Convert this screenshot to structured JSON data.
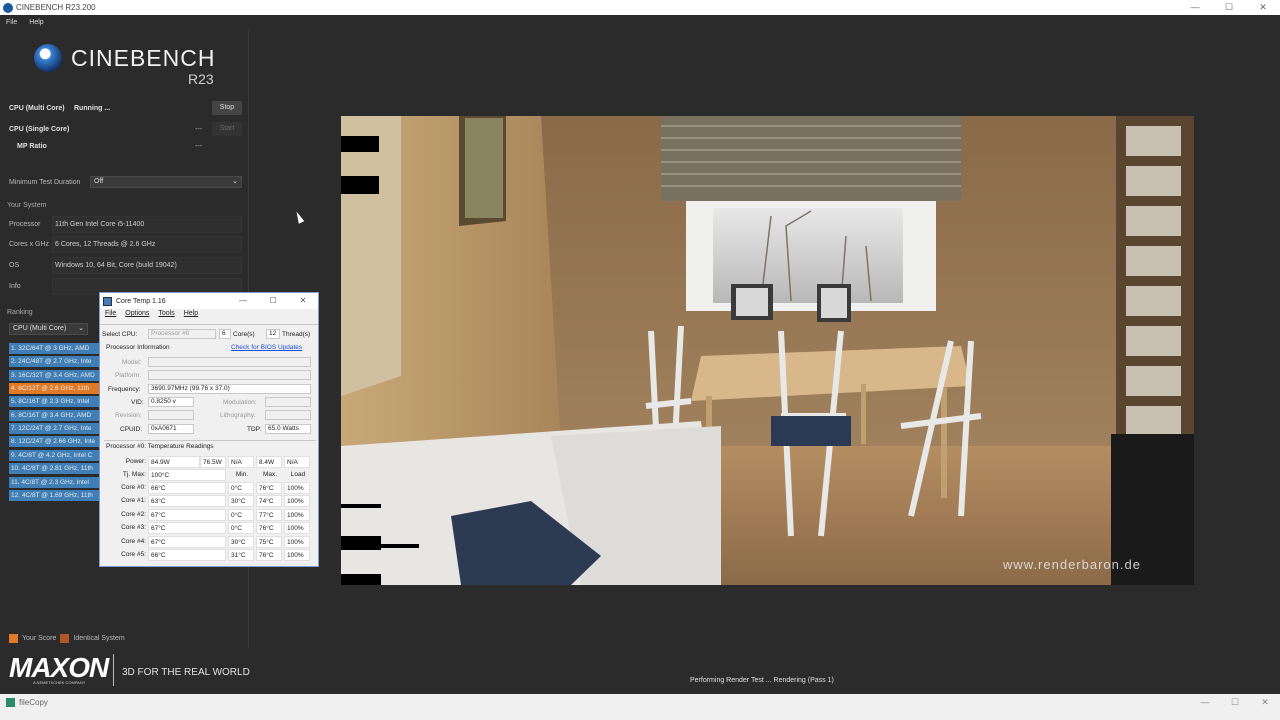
{
  "window": {
    "title": "CINEBENCH R23.200",
    "minimize": "—",
    "maximize": "☐",
    "close": "✕"
  },
  "menu": [
    "File",
    "Help"
  ],
  "logo": {
    "name": "CINEBENCH",
    "version": "R23"
  },
  "tests": {
    "multi": {
      "label": "CPU (Multi Core)",
      "status": "Running ...",
      "button": "Stop"
    },
    "single": {
      "label": "CPU (Single Core)",
      "value": "---",
      "button": "Start"
    },
    "mp": {
      "label": "MP Ratio",
      "value": "---"
    }
  },
  "min_duration": {
    "label": "Minimum Test Duration",
    "value": "Off"
  },
  "system": {
    "heading": "Your System",
    "rows": [
      {
        "label": "Processor",
        "value": "11th Gen Intel Core i5-11400"
      },
      {
        "label": "Cores x GHz",
        "value": "6 Cores, 12 Threads @ 2.6 GHz"
      },
      {
        "label": "OS",
        "value": "Windows 10, 64 Bit, Core (build 19042)"
      },
      {
        "label": "Info",
        "value": ""
      }
    ]
  },
  "ranking": {
    "heading": "Ranking",
    "filter": "CPU (Multi Core)",
    "items": [
      {
        "text": "1. 32C/64T @ 3 GHz, AMD",
        "mine": false
      },
      {
        "text": "2. 24C/48T @ 2.7 GHz, Inte",
        "mine": false
      },
      {
        "text": "3. 16C/32T @ 3.4 GHz, AMD",
        "mine": false
      },
      {
        "text": "4. 6C/12T @ 2.6 GHz, 11th",
        "mine": true
      },
      {
        "text": "5. 8C/16T @ 2.3 GHz, Intel",
        "mine": false
      },
      {
        "text": "6. 8C/16T @ 3.4 GHz, AMD",
        "mine": false
      },
      {
        "text": "7. 12C/24T @ 2.7 GHz, Inte",
        "mine": false
      },
      {
        "text": "8. 12C/24T @ 2.66 GHz, Inte",
        "mine": false
      },
      {
        "text": "9. 4C/8T @ 4.2 GHz, Intel C",
        "mine": false
      },
      {
        "text": "10. 4C/8T @ 2.81 GHz, 11th",
        "mine": false
      },
      {
        "text": "11. 4C/8T @ 2.3 GHz, Intel",
        "mine": false
      },
      {
        "text": "12. 4C/8T @ 1.69 GHz, 11th",
        "mine": false
      }
    ]
  },
  "legend": {
    "your_score": "Your Score",
    "identical": "Identical System",
    "your_color": "#e07a26",
    "identical_color": "#b0572a"
  },
  "brand": {
    "maxon": "MAXON",
    "maxon_sub": "A NEMETSCHEK COMPANY",
    "tagline": "3D FOR THE REAL WORLD"
  },
  "render": {
    "watermark": "www.renderbaron.de"
  },
  "status_line": "Performing Render Test ... Rendering (Pass 1)",
  "taskbar": {
    "title": "fileCopy"
  },
  "coretemp": {
    "title": "Core Temp 1.16",
    "menu": [
      "File",
      "Options",
      "Tools",
      "Help"
    ],
    "select_cpu_label": "Select CPU:",
    "select_cpu_value": "Processor #0",
    "cores_value": "6",
    "cores_label": "Core(s)",
    "threads_value": "12",
    "threads_label": "Thread(s)",
    "proc_info": "Processor Information",
    "bios_link": "Check for BIOS Updates",
    "model_label": "Model:",
    "platform_label": "Platform:",
    "freq_label": "Frequency:",
    "freq_value": "3690.97MHz (99.76 x 37.0)",
    "vid_label": "VID:",
    "vid_value": "0.8250 v",
    "modulation_label": "Modulation:",
    "revision_label": "Revision:",
    "lithography_label": "Lithography:",
    "cpuid_label": "CPUID:",
    "cpuid_value": "0xA0671",
    "tdp_label": "TDP:",
    "tdp_value": "65.0 Watts",
    "temp_heading": "Processor #0: Temperature Readings",
    "power_label": "Power:",
    "power_values": [
      "84.9W",
      "76.5W",
      "N/A",
      "8.4W",
      "N/A"
    ],
    "tj_label": "Tj. Max:",
    "tj_value": "100°C",
    "col_min": "Min.",
    "col_max": "Max.",
    "col_load": "Load",
    "cores": [
      {
        "label": "Core #0:",
        "temp": "66°C",
        "min": "0°C",
        "max": "76°C",
        "load": "100%"
      },
      {
        "label": "Core #1:",
        "temp": "63°C",
        "min": "30°C",
        "max": "74°C",
        "load": "100%"
      },
      {
        "label": "Core #2:",
        "temp": "67°C",
        "min": "0°C",
        "max": "77°C",
        "load": "100%"
      },
      {
        "label": "Core #3:",
        "temp": "67°C",
        "min": "0°C",
        "max": "76°C",
        "load": "100%"
      },
      {
        "label": "Core #4:",
        "temp": "67°C",
        "min": "30°C",
        "max": "75°C",
        "load": "100%"
      },
      {
        "label": "Core #5:",
        "temp": "66°C",
        "min": "31°C",
        "max": "76°C",
        "load": "100%"
      }
    ]
  }
}
